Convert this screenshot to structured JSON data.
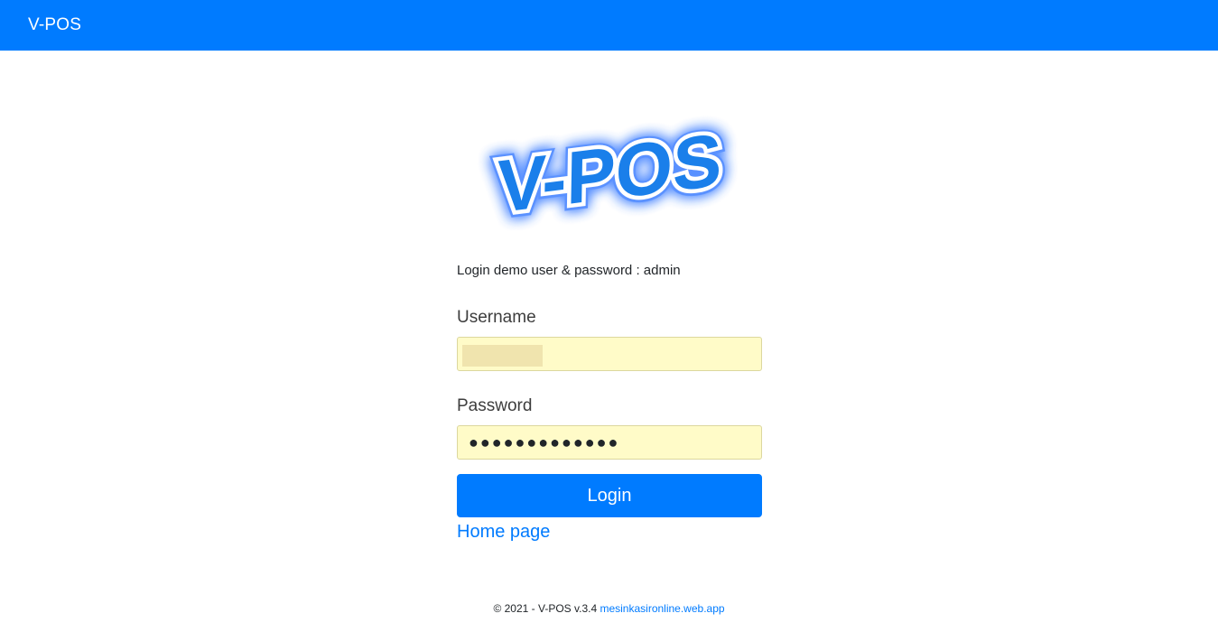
{
  "navbar": {
    "brand": "V-POS"
  },
  "logo": {
    "text": "V-POS",
    "color": "#1a7fea",
    "glow_color": "#2d6cff"
  },
  "login": {
    "hint": "Login demo user & password : admin",
    "username_label": "Username",
    "username_value": "",
    "password_label": "Password",
    "password_value": "●●●●●●●●●●●●●",
    "submit_label": "Login",
    "home_link": "Home page"
  },
  "footer": {
    "copyright": "© 2021 - V-POS v.3.4 ",
    "link_text": "mesinkasironline.web.app"
  },
  "colors": {
    "primary": "#007bff",
    "autofill_bg": "#fffbc8"
  }
}
